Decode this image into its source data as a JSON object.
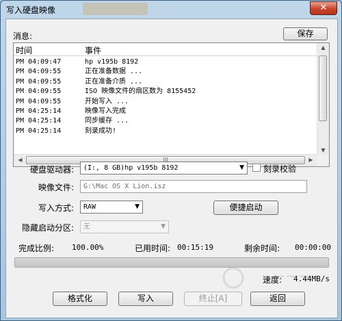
{
  "window": {
    "title": "写入硬盘映像",
    "close_glyph": "✕"
  },
  "messages": {
    "label": "消息:",
    "save_button": "保存",
    "columns": [
      "时间",
      "事件"
    ],
    "rows": [
      {
        "time": "PM 04:09:47",
        "event": "hp      v195b          8192"
      },
      {
        "time": "PM 04:09:55",
        "event": "正在准备数据 ..."
      },
      {
        "time": "PM 04:09:55",
        "event": "正在准备介质 ..."
      },
      {
        "time": "PM 04:09:55",
        "event": "ISO 映像文件的扇区数为 8155452"
      },
      {
        "time": "PM 04:09:55",
        "event": "开始写入 ..."
      },
      {
        "time": "PM 04:25:14",
        "event": "映像写入完成"
      },
      {
        "time": "PM 04:25:14",
        "event": "同步缓存 ..."
      },
      {
        "time": "PM 04:25:14",
        "event": "刻录成功!"
      }
    ],
    "hscroll_grip": "III"
  },
  "form": {
    "drive_label": "硬盘驱动器:",
    "drive_value": "(I:, 8 GB)hp        v195b          8192",
    "verify_label": "刻录校验",
    "image_label": "映像文件:",
    "image_value": "G:\\Mac OS X Lion.isz",
    "write_mode_label": "写入方式:",
    "write_mode_value": "RAW",
    "quick_boot_button": "便捷启动",
    "hidden_partition_label": "隐藏启动分区:",
    "hidden_partition_value": "无"
  },
  "status": {
    "complete_label": "完成比例:",
    "complete_value": "100.00%",
    "elapsed_label": "已用时间:",
    "elapsed_value": "00:15:19",
    "remaining_label": "剩余时间:",
    "remaining_value": "00:00:00",
    "progress_fraction": 1.0,
    "speed_label": "速度:",
    "speed_value": "4.44MB/s"
  },
  "buttons": {
    "format": "格式化",
    "write": "写入",
    "stop": "终止[A]",
    "back": "返回"
  }
}
